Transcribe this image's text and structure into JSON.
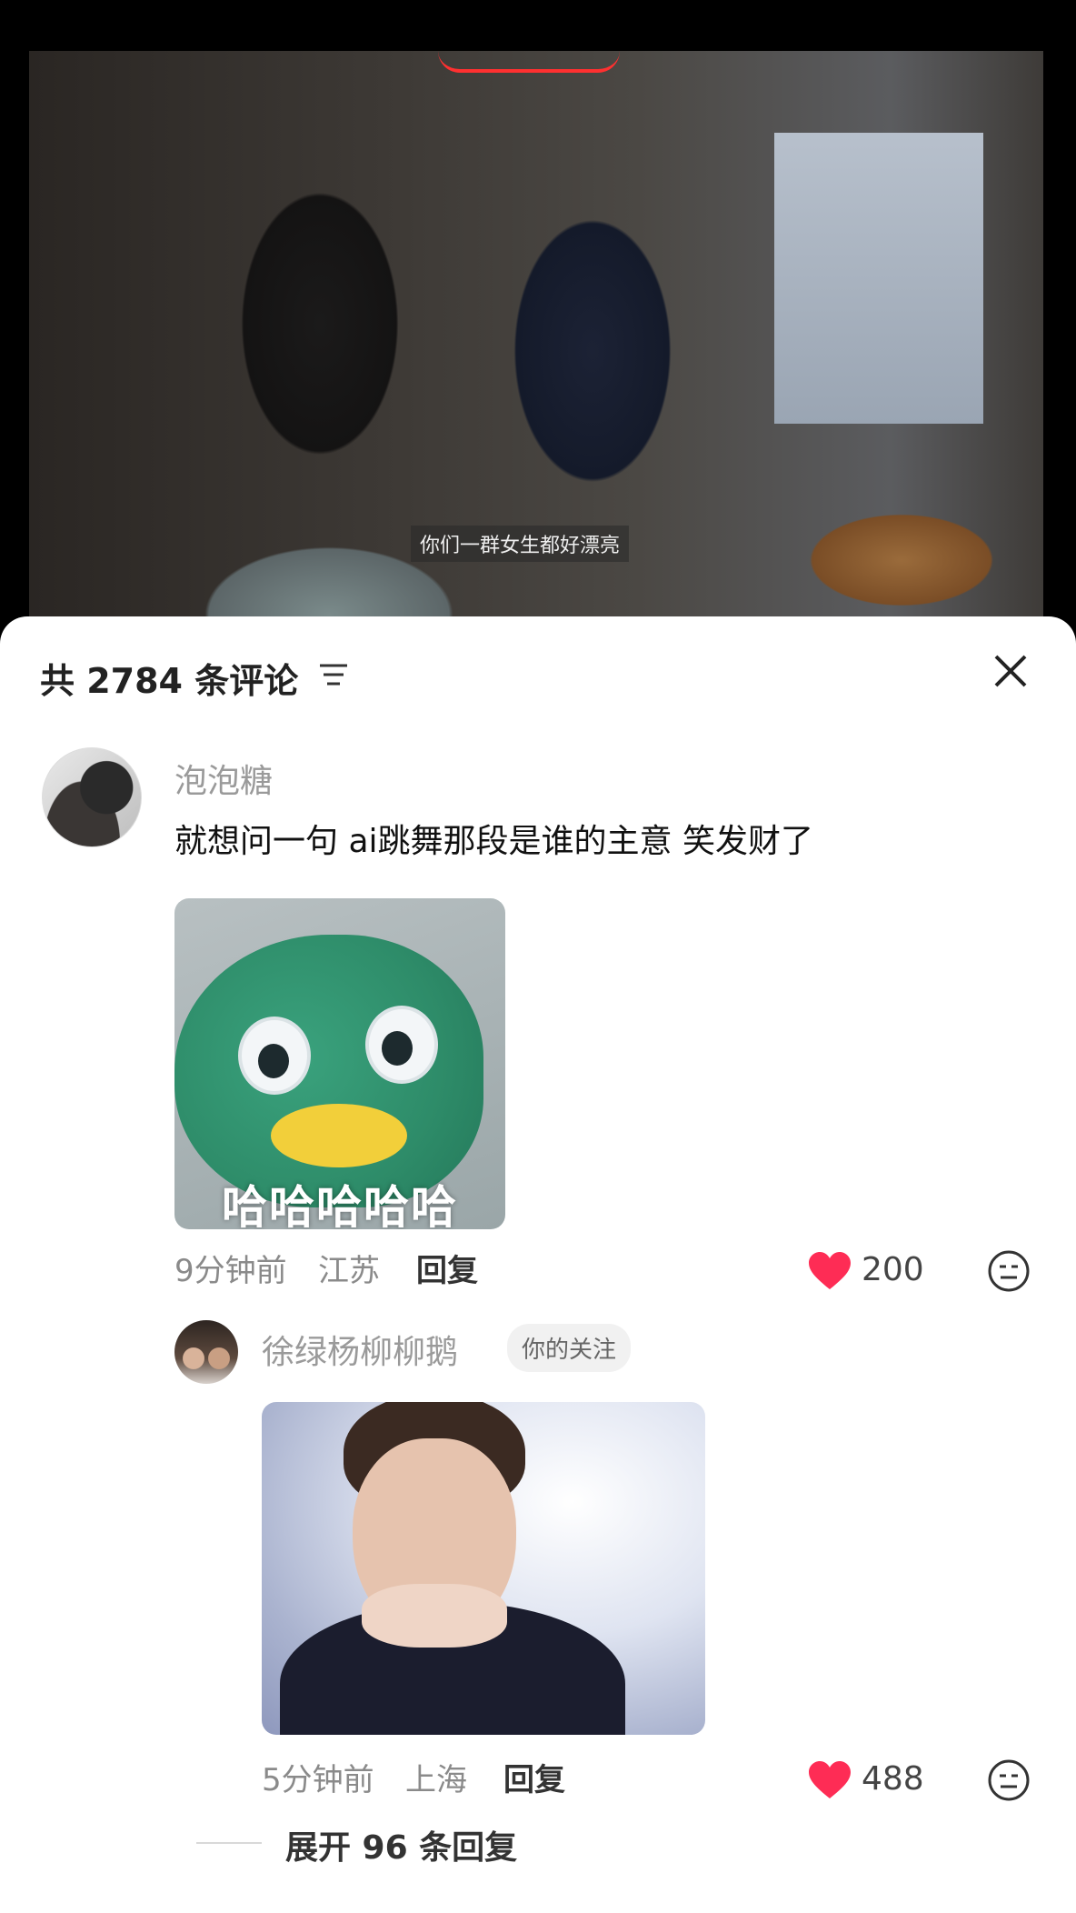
{
  "video": {
    "subtitle": "你们一群女生都好漂亮"
  },
  "comments_header": {
    "title": "共 2784 条评论",
    "filter_icon": "filter-lines-icon",
    "close_icon": "close-x-icon"
  },
  "comment": {
    "username": "泡泡糖",
    "text": "就想问一句 ai跳舞那段是谁的主意 笑发财了",
    "sticker_caption": "哈哈哈哈哈",
    "time": "9分钟前",
    "location": "江苏",
    "reply_label": "回复",
    "likes": "200"
  },
  "reply": {
    "username": "徐绿杨柳柳鹅",
    "badge": "你的关注",
    "time": "5分钟前",
    "location": "上海",
    "reply_label": "回复",
    "likes": "488"
  },
  "expand": {
    "label": "展开 96 条回复"
  },
  "colors": {
    "like_red": "#fe2c55",
    "username_gray": "#9a9a9a"
  }
}
